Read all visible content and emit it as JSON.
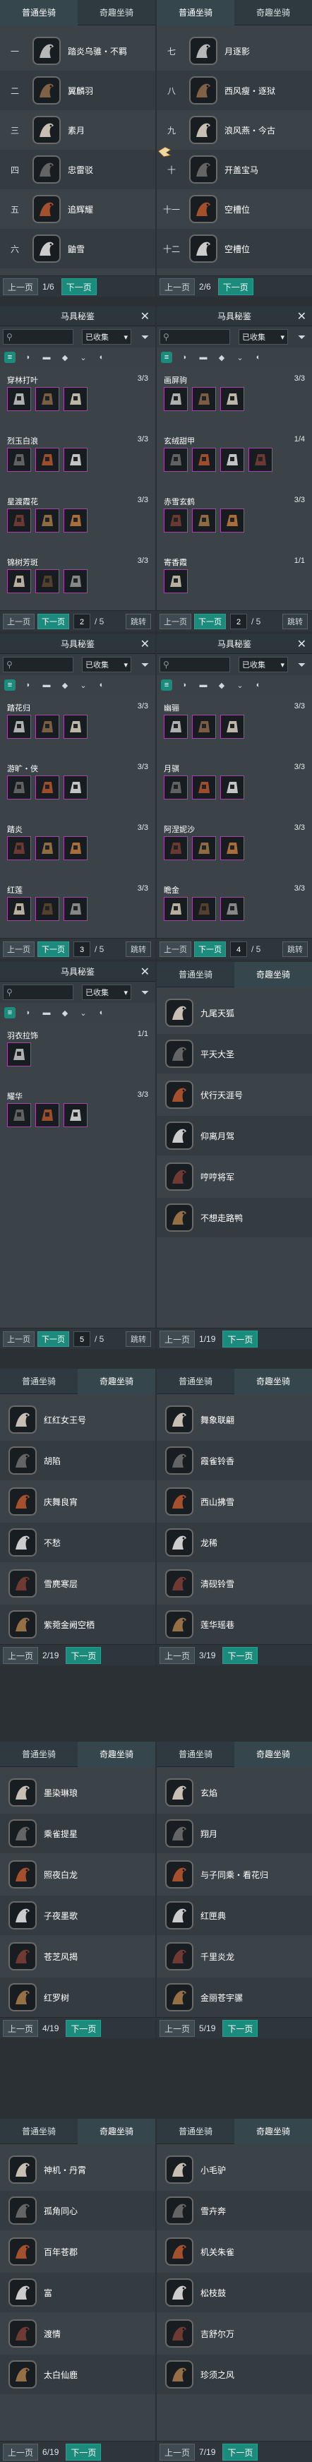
{
  "tabs": {
    "normal": "普通坐骑",
    "special": "奇趣坐骑"
  },
  "pager": {
    "prev": "上一页",
    "next": "下一页"
  },
  "equip_ui": {
    "title": "马具秘鉴",
    "search_placeholder": "",
    "filter_selected": "已收集",
    "page_total": "5",
    "jump": "跳转"
  },
  "p1": {
    "page": "1/6",
    "rows": [
      [
        "一",
        "踏炎乌骓・不羁"
      ],
      [
        "二",
        "翼麟羽"
      ],
      [
        "三",
        "素月"
      ],
      [
        "四",
        "忠雷驳"
      ],
      [
        "五",
        "追辉耀"
      ],
      [
        "六",
        "鼬雪"
      ]
    ]
  },
  "p2": {
    "page": "2/6",
    "rows": [
      [
        "七",
        "月逐影"
      ],
      [
        "八",
        "西风瘦・逐狱"
      ],
      [
        "九",
        "浪风燕・今古"
      ],
      [
        "十",
        "开盖宝马"
      ],
      [
        "十一",
        "空槽位"
      ],
      [
        "十二",
        "空槽位"
      ]
    ]
  },
  "e1": {
    "page": "2",
    "sets": [
      [
        "穿林打叶",
        "3/3"
      ],
      [
        "烈玉白浪",
        "3/3"
      ],
      [
        "星渡霞花",
        "3/3"
      ],
      [
        "锦树芳斑",
        "3/3"
      ]
    ]
  },
  "e2": {
    "page": "2",
    "sets": [
      [
        "画屏驹",
        "3/3"
      ],
      [
        "玄绒甜甲",
        "1/4"
      ],
      [
        "赤雪玄鹤",
        "3/3"
      ],
      [
        "寄香霞",
        "1/1"
      ]
    ]
  },
  "e3": {
    "page": "3",
    "sets": [
      [
        "踏花归",
        "3/3"
      ],
      [
        "游旷・侠",
        "3/3"
      ],
      [
        "踏炎",
        "3/3"
      ],
      [
        "红莲",
        "3/3"
      ]
    ]
  },
  "e4": {
    "page": "4",
    "sets": [
      [
        "幽骊",
        "3/3"
      ],
      [
        "月骐",
        "3/3"
      ],
      [
        "阿涅妮沙",
        "3/3"
      ],
      [
        "瞻金",
        "3/3"
      ]
    ]
  },
  "e5": {
    "page": "5",
    "sets": [
      [
        "羽衣拉饰",
        "1/1"
      ],
      [
        "耀华",
        "3/3"
      ]
    ]
  },
  "s1": {
    "page": "1/19",
    "rows": [
      "九尾天狐",
      "平天大圣",
      "伏行天涯号",
      "仰离月驾",
      "哼哼将军",
      "不想走路鸭"
    ]
  },
  "s2": {
    "page": "2/19",
    "rows": [
      "红红女王号",
      "胡陷",
      "庆舞良宵",
      "不愁",
      "雪麂寒层",
      "紫菀金阙空栖"
    ]
  },
  "s3": {
    "page": "3/19",
    "rows": [
      "舞象联翩",
      "霞雀铃香",
      "西山拂雪",
      "龙稀",
      "清砚铃雪",
      "莲华瑶巷"
    ]
  },
  "s4": {
    "page": "4/19",
    "rows": [
      "墨染琳琅",
      "乘雀提星",
      "照夜白龙",
      "子夜墨歌",
      "苍芝风揭",
      "红罗树"
    ]
  },
  "s5": {
    "page": "5/19",
    "rows": [
      "玄焰",
      "翔月",
      "与子同乘・看花归",
      "红匣典",
      "千里炎龙",
      "金丽苍宇骡"
    ]
  },
  "s6": {
    "page": "6/19",
    "rows": [
      "神机・丹霄",
      "孤角同心",
      "百年苍郡",
      "富",
      "渡情",
      "太白仙鹿"
    ]
  },
  "s7": {
    "page": "7/19",
    "rows": [
      "小毛驴",
      "雪卉奔",
      "机关朱雀",
      "松枝鼓",
      "吉舒尔万",
      "珍须之风"
    ]
  },
  "colors": {
    "accent": "#1b8b7c",
    "slot_border": "#a444a6",
    "panel_bg": "#3c4348"
  },
  "icons": [
    "mount-portrait-icon",
    "search-icon",
    "filter-icon",
    "close-icon",
    "gear-slot-icon",
    "cursor-icon",
    "chevron-down-icon"
  ]
}
